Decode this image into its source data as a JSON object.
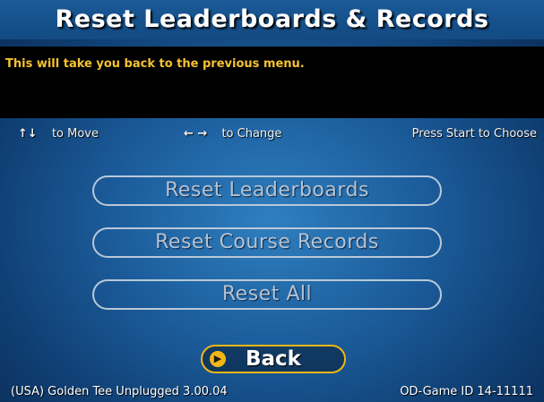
{
  "title": "Reset Leaderboards & Records",
  "info": "This will take you back to the previous menu.",
  "controls": {
    "move_arrows": "↑↓",
    "move_label": "to Move",
    "change_arrows": "← →",
    "change_label": "to Change",
    "choose_label": "Press Start to Choose"
  },
  "menu": [
    {
      "label": "Reset Leaderboards"
    },
    {
      "label": "Reset Course Records"
    },
    {
      "label": "Reset All"
    }
  ],
  "back": {
    "label": "Back",
    "icon": "chevron-right-icon"
  },
  "footer": {
    "left": "(USA) Golden Tee Unplugged 3.00.04",
    "right": "OD-Game ID 14-11111"
  },
  "colors": {
    "accent": "#f2b615",
    "info_text": "#f5c232",
    "inactive_button": "#b6c3d2"
  }
}
